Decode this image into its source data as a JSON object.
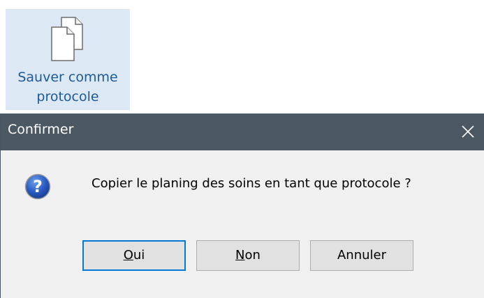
{
  "ribbon": {
    "save_as_protocol_line1": "Sauver comme",
    "save_as_protocol_line2": "protocole",
    "icon": "document-copy-icon"
  },
  "dialog": {
    "title": "Confirmer",
    "close_icon": "close-icon",
    "question_icon": "question-icon",
    "message": "Copier le planing des soins en tant que protocole ?",
    "buttons": {
      "yes_mnemonic": "O",
      "yes_rest": "ui",
      "no_mnemonic": "N",
      "no_rest": "on",
      "cancel": "Annuler"
    }
  },
  "colors": {
    "titlebar": "#4c5764",
    "dialog_bg": "#f0f0f0",
    "ribbon_bg": "#dde8f5",
    "accent": "#0078d7"
  }
}
